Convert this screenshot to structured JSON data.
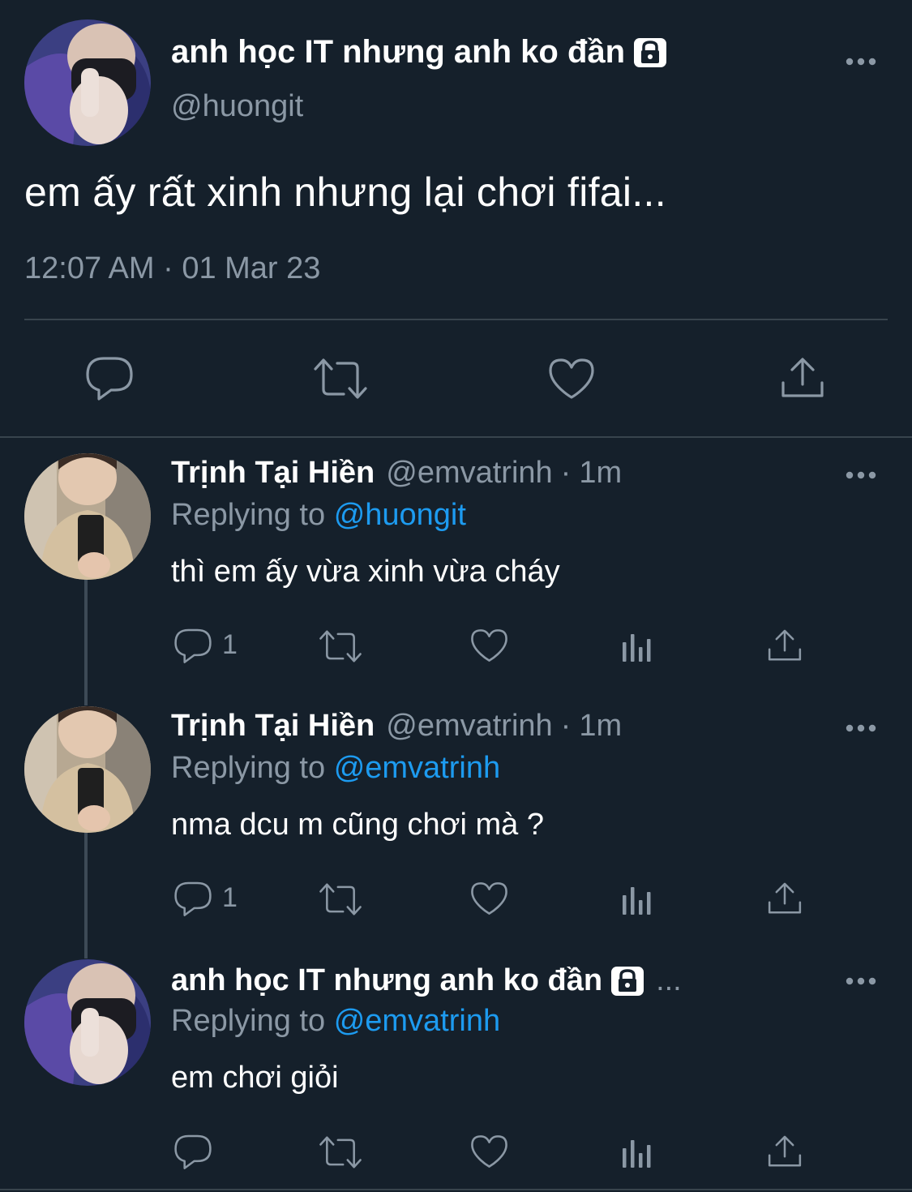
{
  "tweet": {
    "author_name": "anh học IT nhưng anh ko đần",
    "author_handle": "@huongit",
    "text": "em ấy rất xinh nhưng lại chơi fifai...",
    "timestamp": "12:07 AM · 01 Mar 23",
    "icons": [
      "reply-icon",
      "retweet-icon",
      "like-icon",
      "share-icon"
    ]
  },
  "replies": [
    {
      "name": "Trịnh Tại Hiền",
      "handle": "@emvatrinh",
      "separator": "·",
      "time": "1m",
      "replying_label": "Replying to",
      "replying_to": "@huongit",
      "text": "thì em ấy vừa xinh vừa cháy",
      "reply_count": "1"
    },
    {
      "name": "Trịnh Tại Hiền",
      "handle": "@emvatrinh",
      "separator": "·",
      "time": "1m",
      "replying_label": "Replying to",
      "replying_to": "@emvatrinh",
      "text": "nma dcu m cũng chơi mà ?",
      "reply_count": "1"
    },
    {
      "name": "anh học IT nhưng anh ko đần",
      "truncation": "...",
      "replying_label": "Replying to",
      "replying_to": "@emvatrinh",
      "text": "em chơi giỏi"
    }
  ],
  "colors": {
    "background": "#15202b",
    "text": "#ffffff",
    "secondary": "#8b98a5",
    "link": "#1d9bf0",
    "divider": "#38444d"
  }
}
